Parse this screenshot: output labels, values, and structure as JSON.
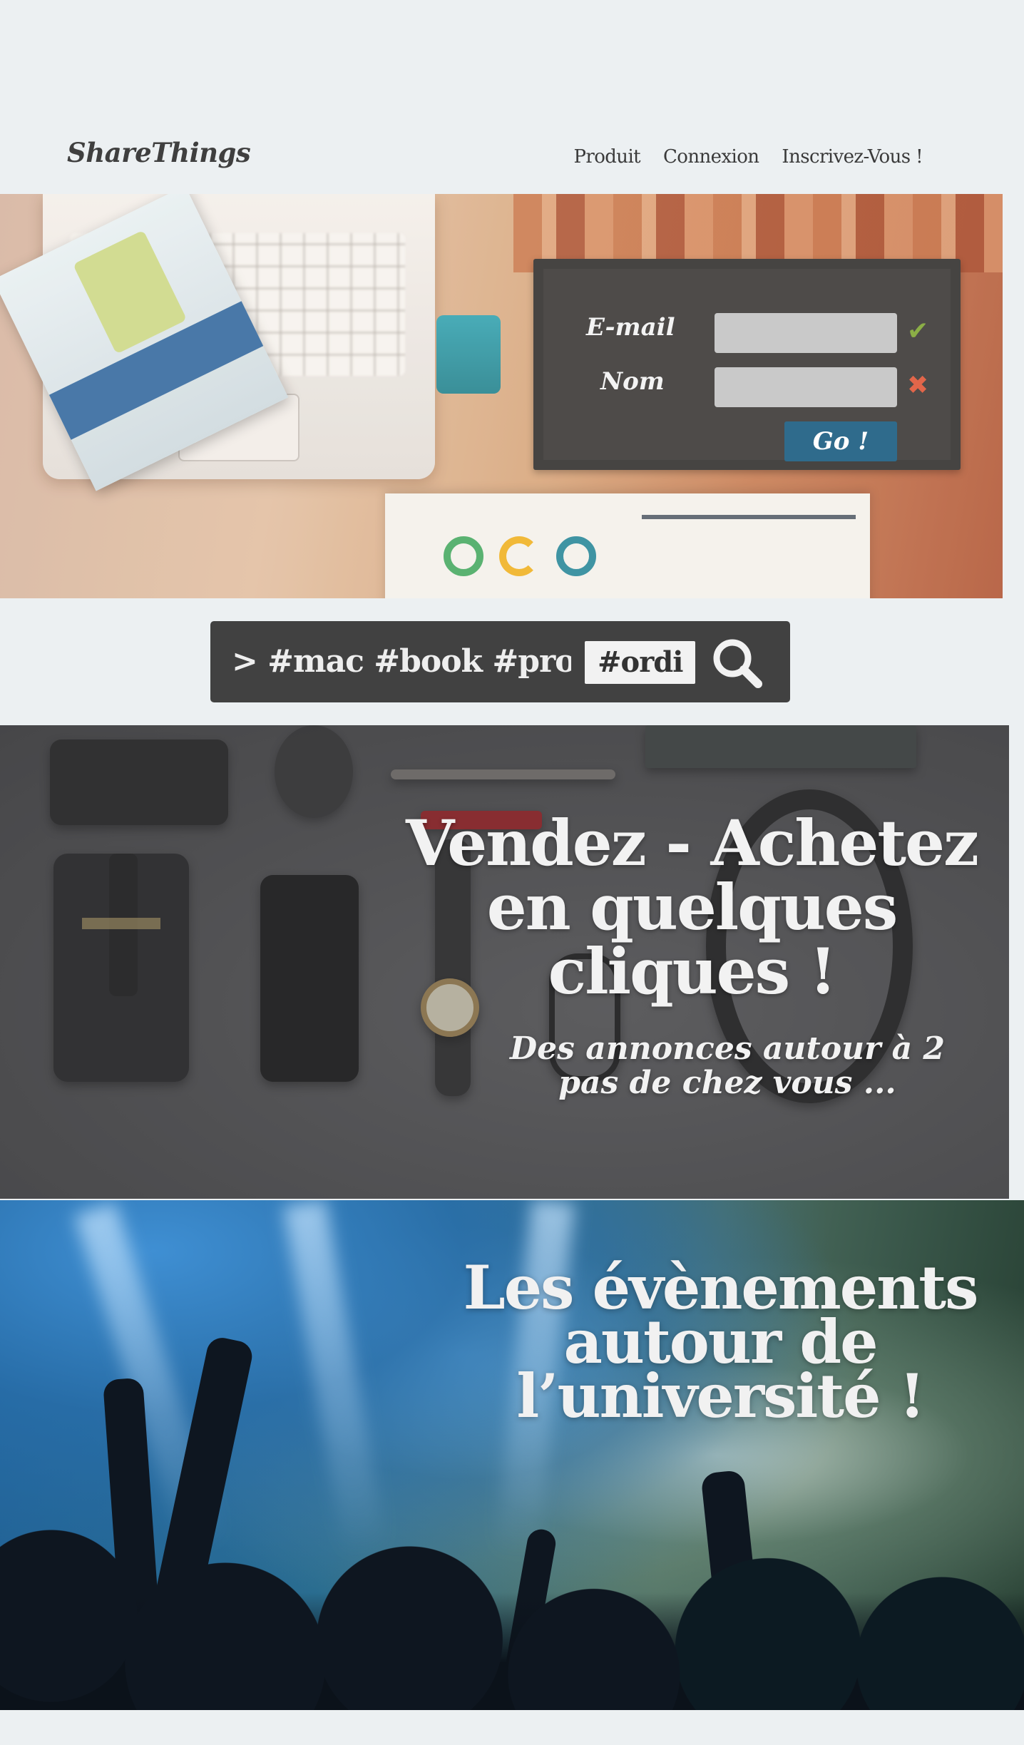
{
  "header": {
    "logo": "ShareThings",
    "nav": [
      "Produit",
      "Connexion",
      "Inscrivez-Vous !"
    ]
  },
  "login": {
    "email_label": "E-mail",
    "name_label": "Nom",
    "email_value": "",
    "name_value": "",
    "email_status": "valid",
    "email_status_icon": "✔",
    "name_status": "invalid",
    "name_status_icon": "✖",
    "submit_label": "Go !",
    "colors": {
      "panel": "#464442",
      "field": "#c9c9c9",
      "button": "#2f6b8c",
      "valid": "#8bae46",
      "invalid": "#e2664a"
    }
  },
  "search": {
    "query": "> #mac #book #pro",
    "tag": "#ordi",
    "button_icon": "search-icon"
  },
  "sell_section": {
    "headline": "Vendez - Achetez en quelques cliques !",
    "subtitle": "Des annonces autour à 2 pas de chez vous ..."
  },
  "events_section": {
    "headline": "Les évènements autour de l’université !"
  }
}
